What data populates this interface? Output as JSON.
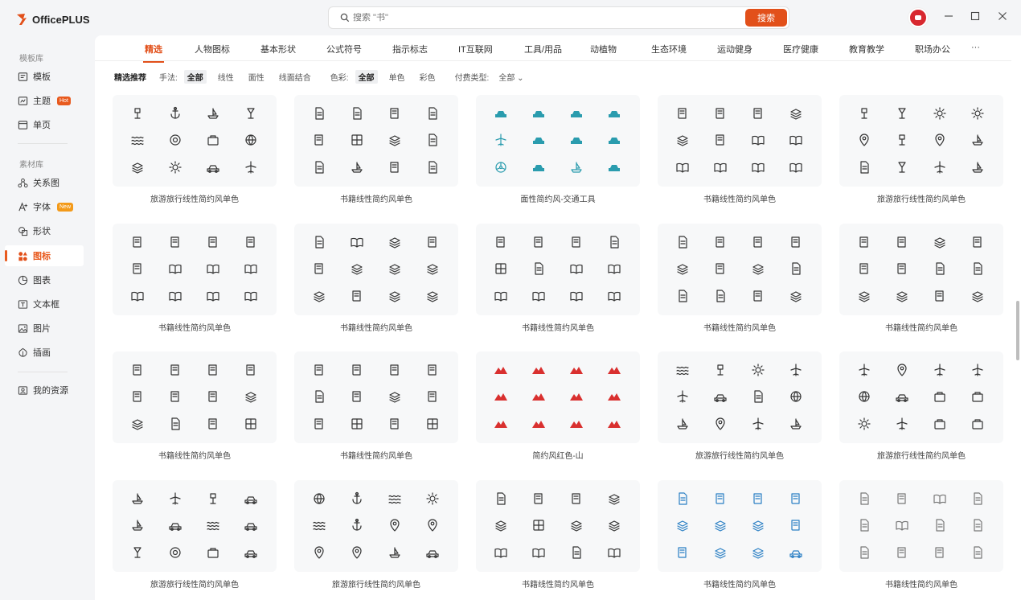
{
  "app": {
    "title": "OfficePLUS"
  },
  "sidebar": {
    "template_section": "模板库",
    "material_section": "素材库",
    "items": [
      {
        "label": "模板",
        "icon": "template-icon"
      },
      {
        "label": "主题",
        "icon": "theme-icon",
        "badge": "Hot"
      },
      {
        "label": "单页",
        "icon": "page-icon"
      },
      {
        "label": "关系图",
        "icon": "relation-icon"
      },
      {
        "label": "字体",
        "icon": "font-icon",
        "badge": "New"
      },
      {
        "label": "形状",
        "icon": "shape-icon"
      },
      {
        "label": "图标",
        "icon": "icons-icon",
        "active": true
      },
      {
        "label": "图表",
        "icon": "chart-icon"
      },
      {
        "label": "文本框",
        "icon": "textbox-icon"
      },
      {
        "label": "图片",
        "icon": "picture-icon"
      },
      {
        "label": "插画",
        "icon": "illustration-icon"
      },
      {
        "label": "我的资源",
        "icon": "my-resources-icon"
      }
    ]
  },
  "search": {
    "placeholder": "搜索 \"书\"",
    "button": "搜索"
  },
  "tabs": [
    "精选",
    "人物图标",
    "基本形状",
    "公式符号",
    "指示标志",
    "IT互联网",
    "工具/用品",
    "动植物",
    "生态环境",
    "运动健身",
    "医疗健康",
    "教育教学",
    "职场办公",
    "···"
  ],
  "filters": {
    "title": "精选推荐",
    "style_label": "手法:",
    "style_options": [
      "全部",
      "线性",
      "面性",
      "线面结合"
    ],
    "color_label": "色彩:",
    "color_options": [
      "全部",
      "单色",
      "彩色"
    ],
    "pay_label": "付费类型:",
    "pay_value": "全部"
  },
  "colors": {
    "accent": "#e2501a",
    "teal": "#2a9cae",
    "red": "#d9302f",
    "blue": "#2a7fc4",
    "dark": "#333333",
    "gray": "#777777"
  },
  "cards": [
    {
      "title": "旅游旅行线性简约风单色",
      "color": "dark"
    },
    {
      "title": "书籍线性简约风单色",
      "color": "dark"
    },
    {
      "title": "面性简约风-交通工具",
      "color": "teal"
    },
    {
      "title": "书籍线性简约风单色",
      "color": "dark"
    },
    {
      "title": "旅游旅行线性简约风单色",
      "color": "dark"
    },
    {
      "title": "书籍线性简约风单色",
      "color": "dark"
    },
    {
      "title": "书籍线性简约风单色",
      "color": "dark"
    },
    {
      "title": "书籍线性简约风单色",
      "color": "dark"
    },
    {
      "title": "书籍线性简约风单色",
      "color": "dark"
    },
    {
      "title": "书籍线性简约风单色",
      "color": "dark"
    },
    {
      "title": "书籍线性简约风单色",
      "color": "dark"
    },
    {
      "title": "书籍线性简约风单色",
      "color": "dark"
    },
    {
      "title": "简约风红色-山",
      "color": "red"
    },
    {
      "title": "旅游旅行线性简约风单色",
      "color": "dark"
    },
    {
      "title": "旅游旅行线性简约风单色",
      "color": "dark"
    },
    {
      "title": "旅游旅行线性简约风单色",
      "color": "dark"
    },
    {
      "title": "旅游旅行线性简约风单色",
      "color": "dark"
    },
    {
      "title": "书籍线性简约风单色",
      "color": "dark"
    },
    {
      "title": "书籍线性简约风单色",
      "color": "blue"
    },
    {
      "title": "书籍线性简约风单色",
      "color": "gray"
    }
  ]
}
